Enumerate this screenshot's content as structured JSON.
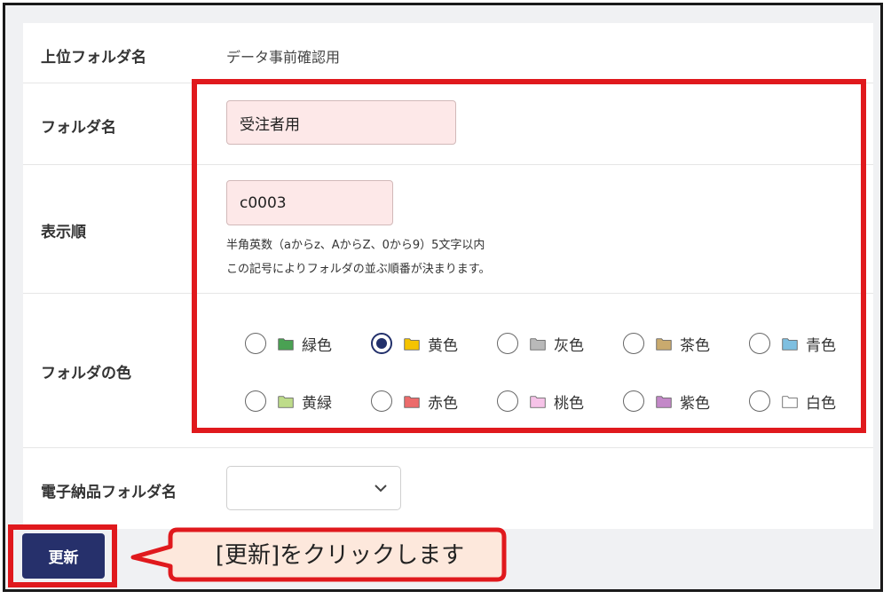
{
  "form": {
    "parent_folder_label": "上位フォルダ名",
    "parent_folder_value": "データ事前確認用",
    "folder_name_label": "フォルダ名",
    "folder_name_value": "受注者用",
    "display_order_label": "表示順",
    "display_order_value": "c0003",
    "display_order_help_1": "半角英数（aからz、AからZ、0から9）5文字以内",
    "display_order_help_2": "この記号によりフォルダの並ぶ順番が決まります。",
    "folder_color_label": "フォルダの色",
    "electronic_folder_label": "電子納品フォルダ名",
    "electronic_folder_value": ""
  },
  "colors": [
    {
      "label": "緑色",
      "hex": "#4aa153",
      "checked": false
    },
    {
      "label": "黄色",
      "hex": "#f5c400",
      "checked": true
    },
    {
      "label": "灰色",
      "hex": "#b9b9b9",
      "checked": false
    },
    {
      "label": "茶色",
      "hex": "#c9aa6e",
      "checked": false
    },
    {
      "label": "青色",
      "hex": "#7ebfe0",
      "checked": false
    },
    {
      "label": "黄緑",
      "hex": "#bedc8a",
      "checked": false
    },
    {
      "label": "赤色",
      "hex": "#ec6b6b",
      "checked": false
    },
    {
      "label": "桃色",
      "hex": "#f6c3e8",
      "checked": false
    },
    {
      "label": "紫色",
      "hex": "#c388c8",
      "checked": false
    },
    {
      "label": "白色",
      "hex": "#ffffff",
      "checked": false
    }
  ],
  "actions": {
    "update_label": "更新"
  },
  "annotation": {
    "callout_text": "[更新]をクリックします",
    "highlight_color": "#e0191d",
    "callout_bg": "#fde8dc"
  },
  "theme": {
    "primary": "#26306b",
    "input_bg": "#fde8e8"
  }
}
